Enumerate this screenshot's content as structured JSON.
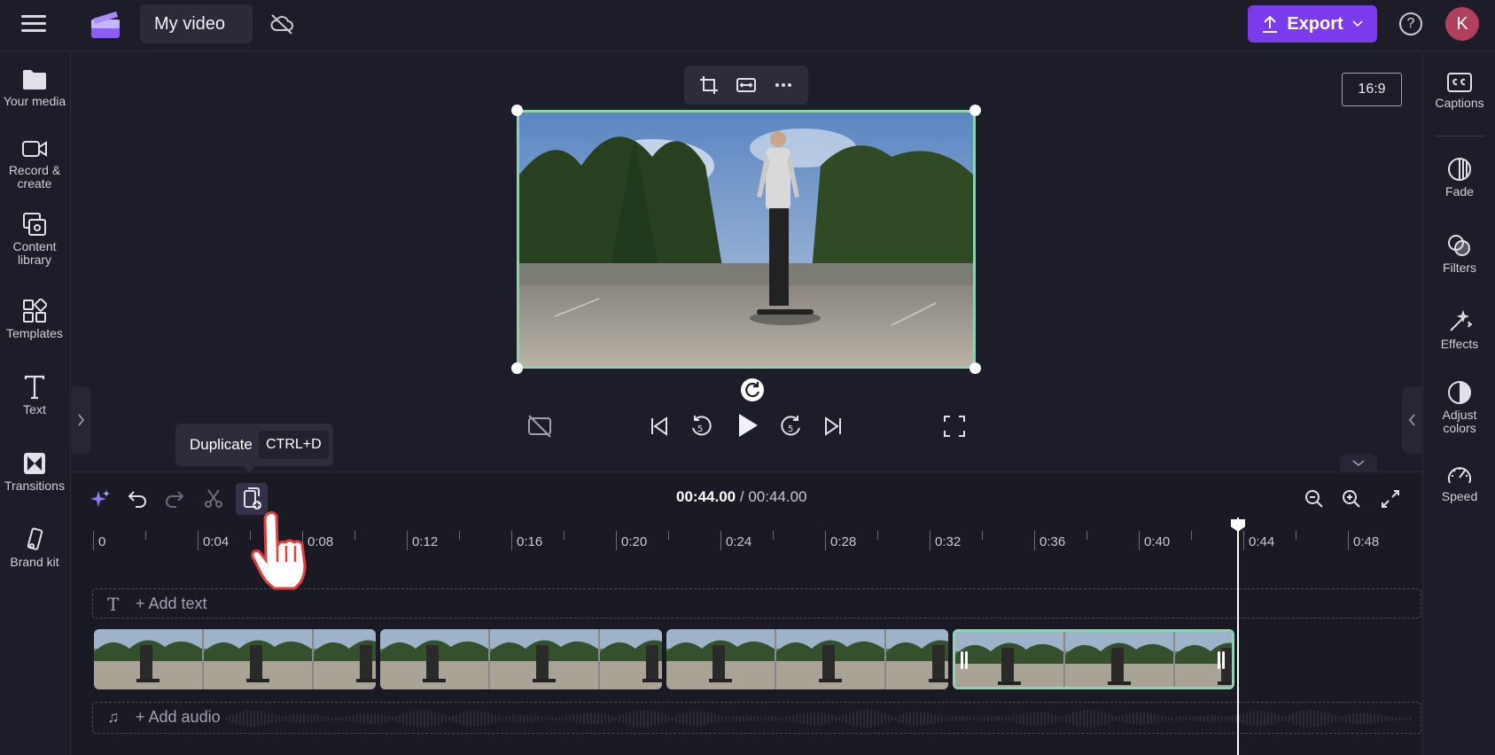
{
  "topbar": {
    "project_title": "My video",
    "export_label": "Export",
    "help_glyph": "?",
    "avatar_initial": "K",
    "icons": [
      "hamburger-menu-icon",
      "app-logo-icon",
      "cloud-off-icon",
      "upload-icon",
      "chevron-down-icon",
      "help-icon"
    ]
  },
  "left_sidebar": {
    "items": [
      {
        "label": "Your media",
        "icon": "folder-icon"
      },
      {
        "label": "Record & create",
        "icon": "video-camera-icon"
      },
      {
        "label": "Content library",
        "icon": "content-library-icon"
      },
      {
        "label": "Templates",
        "icon": "templates-icon"
      },
      {
        "label": "Text",
        "icon": "text-icon"
      },
      {
        "label": "Transitions",
        "icon": "transitions-icon"
      },
      {
        "label": "Brand kit",
        "icon": "brand-kit-icon"
      }
    ]
  },
  "right_sidebar": {
    "items": [
      {
        "label": "Captions",
        "icon": "captions-icon"
      },
      {
        "label": "Fade",
        "icon": "fade-icon"
      },
      {
        "label": "Filters",
        "icon": "filters-icon"
      },
      {
        "label": "Effects",
        "icon": "effects-icon"
      },
      {
        "label": "Adjust colors",
        "icon": "adjust-colors-icon"
      },
      {
        "label": "Speed",
        "icon": "speed-icon"
      }
    ]
  },
  "preview": {
    "aspect_ratio": "16:9",
    "toolbar_icons": [
      "crop-icon",
      "fit-icon",
      "more-icon"
    ]
  },
  "playback": {
    "icons": [
      "captions-off-icon",
      "skip-back-icon",
      "rewind-5-icon",
      "play-icon",
      "forward-5-icon",
      "skip-forward-icon",
      "fullscreen-icon"
    ]
  },
  "tooltip": {
    "label": "Duplicate",
    "shortcut": "CTRL+D"
  },
  "timeline": {
    "current_time": "00:44.00",
    "separator": "/",
    "total_time": "00:44.00",
    "ruler_labels": [
      "0",
      "0:04",
      "0:08",
      "0:12",
      "0:16",
      "0:20",
      "0:24",
      "0:28",
      "0:32",
      "0:36",
      "0:40",
      "0:44",
      "0:48"
    ],
    "add_text_label": "+ Add text",
    "add_audio_label": "+ Add audio",
    "clip_count": 4,
    "selected_clip": 4,
    "tools": [
      "magic-icon",
      "undo-icon",
      "redo-icon",
      "scissors-icon",
      "duplicate-icon"
    ],
    "zoom_tools": [
      "zoom-out-icon",
      "zoom-in-icon",
      "fit-timeline-icon"
    ]
  },
  "colors": {
    "accent": "#7c3aed",
    "selection": "#8fd1b1",
    "background": "#1d1d29"
  }
}
